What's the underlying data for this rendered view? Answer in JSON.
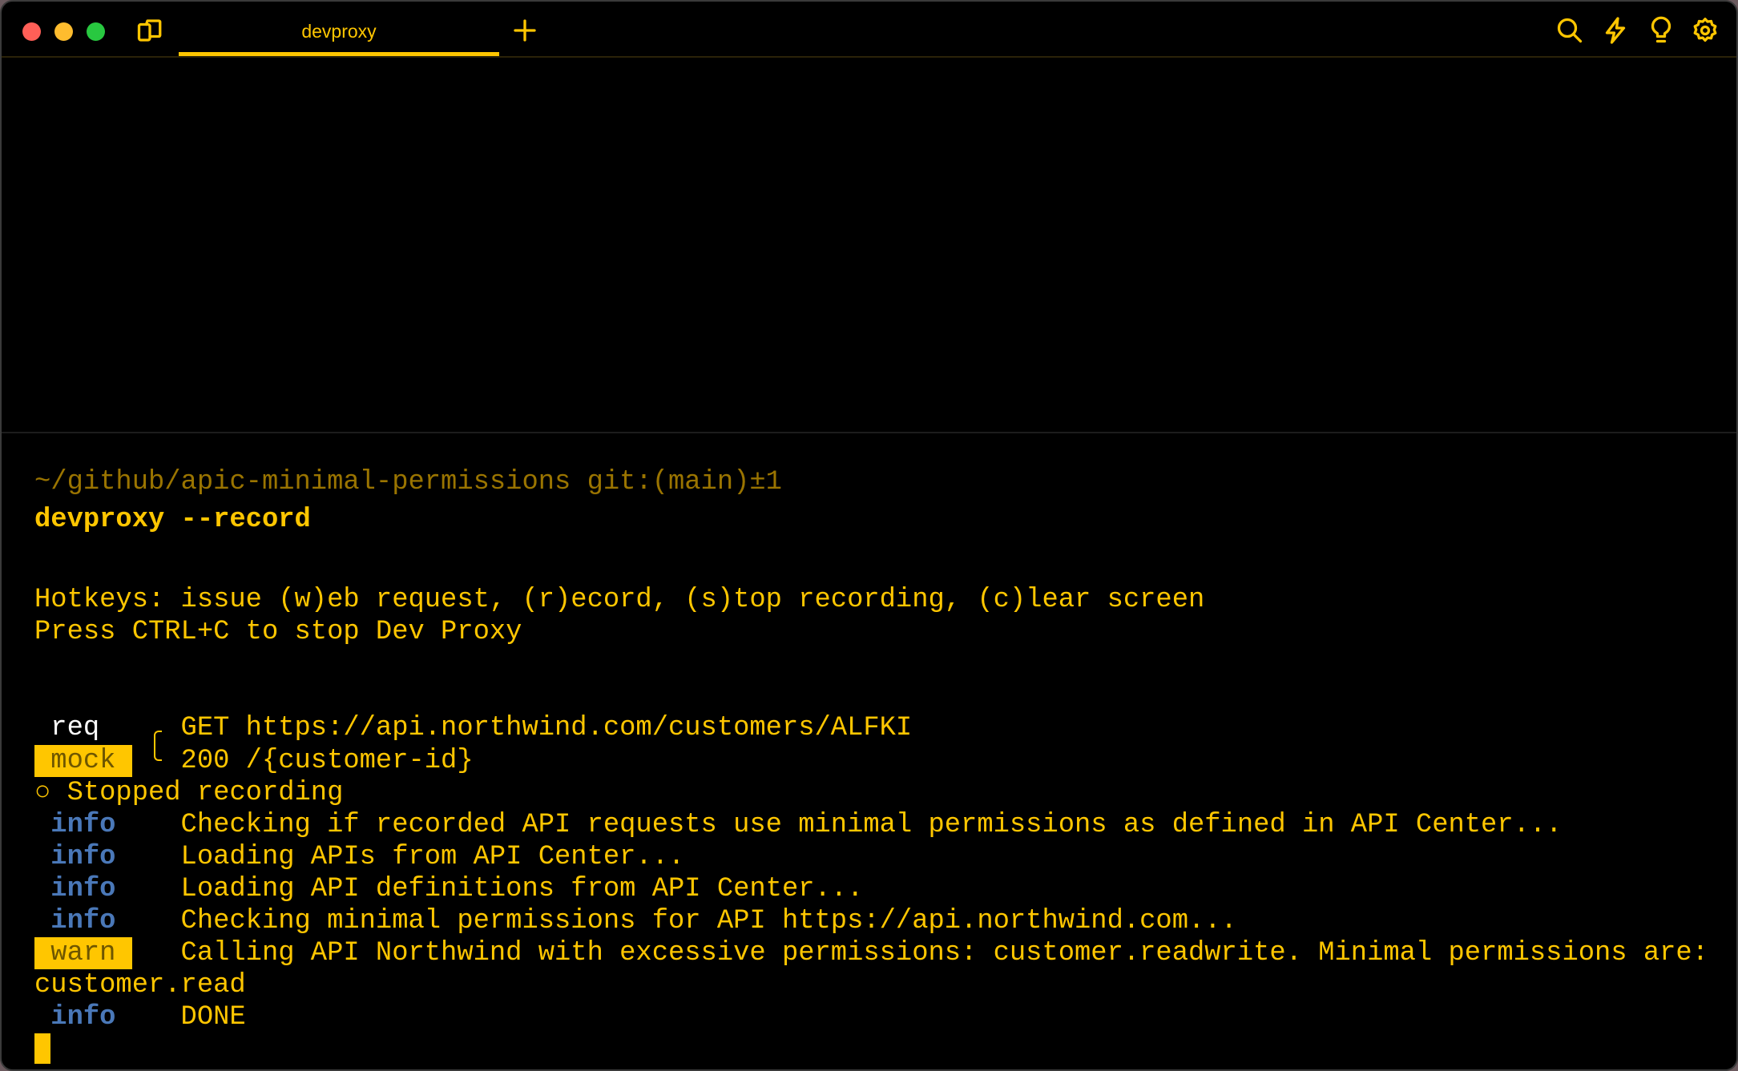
{
  "window": {
    "tab_title": "devproxy",
    "colors": {
      "accent": "#ffc600",
      "info": "#4a78b8",
      "close": "#ff5f57",
      "minimize": "#febc2e",
      "zoom": "#28c840"
    }
  },
  "toolbar": {
    "icons": [
      "search-icon",
      "bolt-icon",
      "lightbulb-icon",
      "gear-icon"
    ]
  },
  "terminal": {
    "prompt_path": "~/github/apic-minimal-permissions git:(main)±1",
    "command": "devproxy --record",
    "hotkeys": "Hotkeys: issue (w)eb request, (r)ecord, (s)top recording, (c)lear screen",
    "press": "Press CTRL+C to stop Dev Proxy",
    "req_label": "req",
    "req_msg": "GET https://api.northwind.com/customers/ALFKI",
    "mock_label": "mock",
    "mock_msg": "200 /{customer-id}",
    "stopped": "○ Stopped recording",
    "logs": [
      {
        "label": "info",
        "msg": "Checking if recorded API requests use minimal permissions as defined in API Center..."
      },
      {
        "label": "info",
        "msg": "Loading APIs from API Center..."
      },
      {
        "label": "info",
        "msg": "Loading API definitions from API Center..."
      },
      {
        "label": "info",
        "msg": "Checking minimal permissions for API https://api.northwind.com..."
      },
      {
        "label": "warn",
        "msg": "Calling API Northwind with excessive permissions: customer.readwrite. Minimal permissions are:"
      }
    ],
    "warn_wrap": "customer.read",
    "done_label": "info",
    "done_msg": "DONE"
  }
}
